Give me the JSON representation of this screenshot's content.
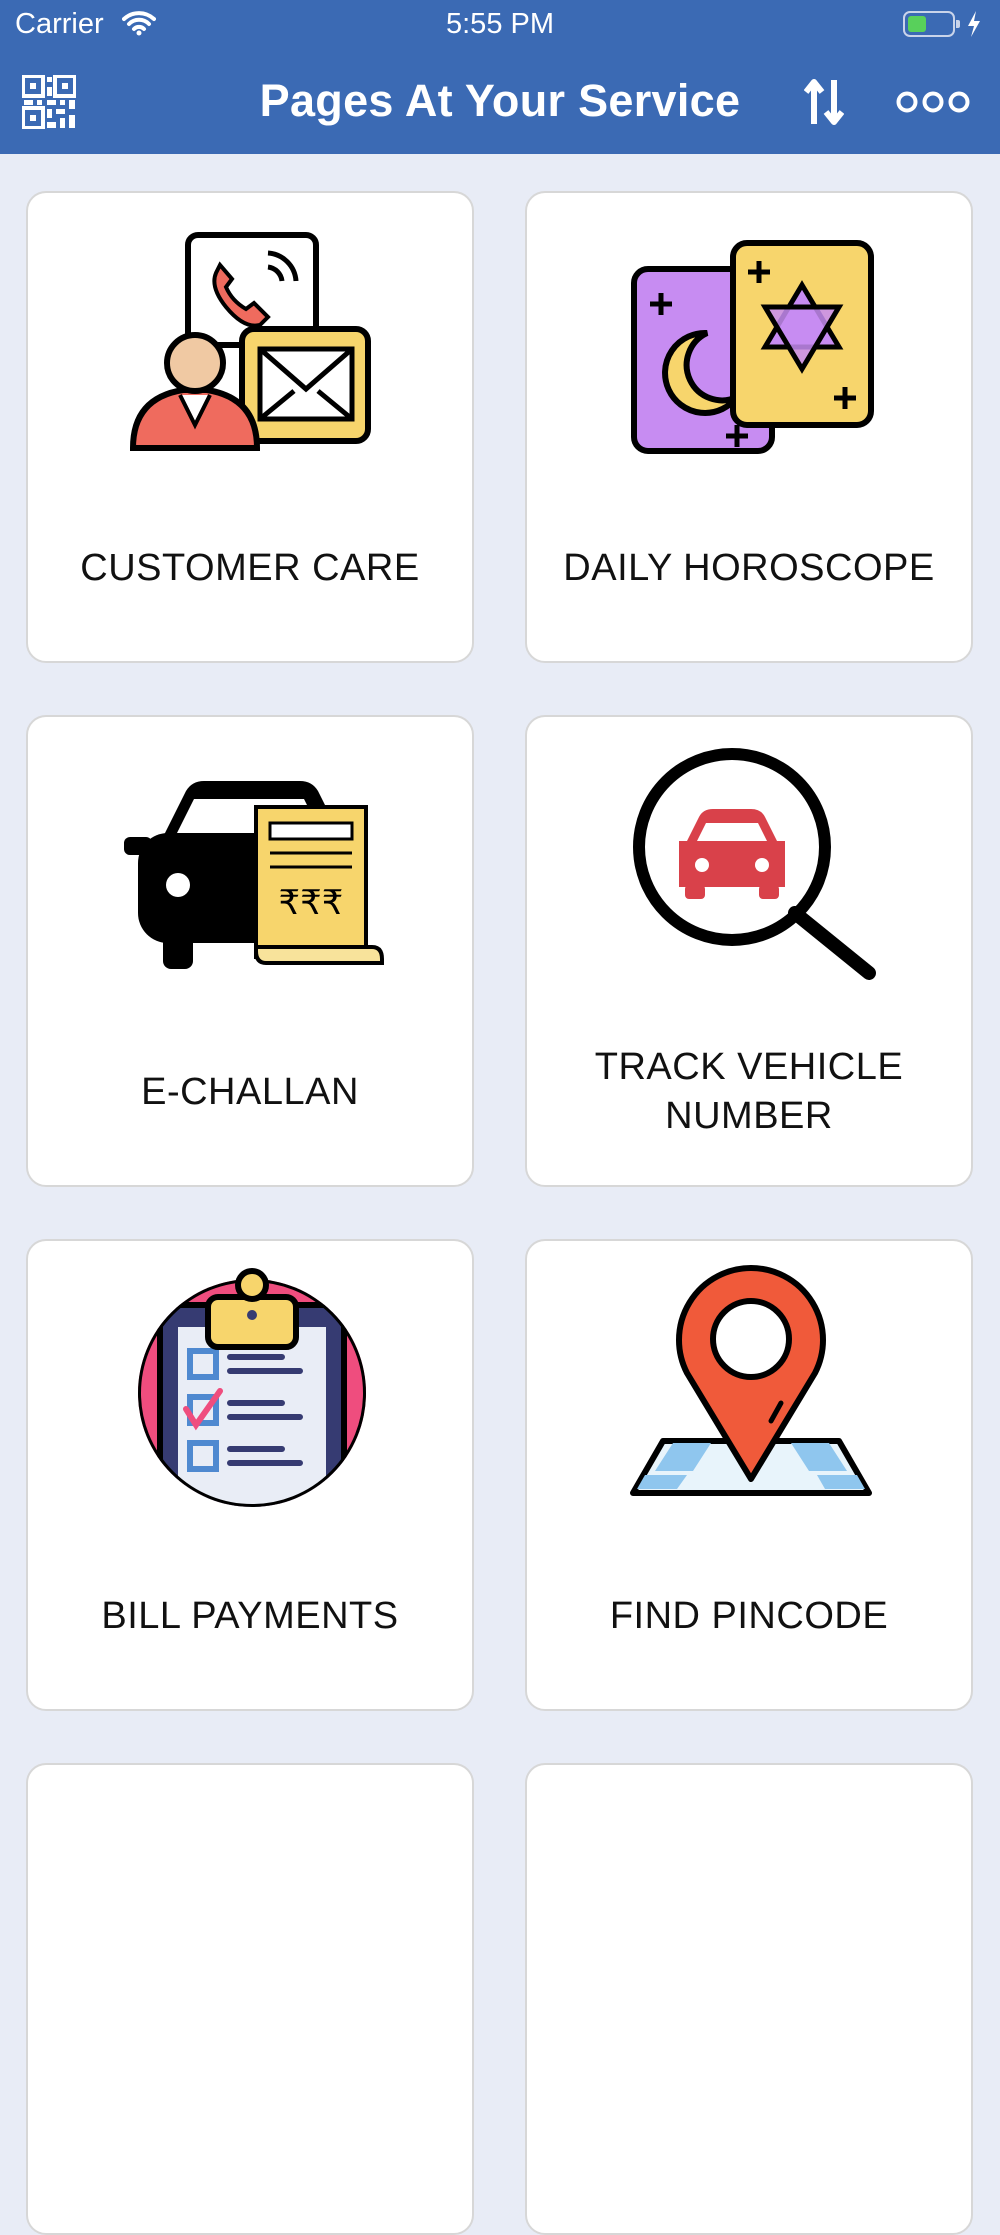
{
  "status_bar": {
    "carrier": "Carrier",
    "time": "5:55 PM"
  },
  "nav": {
    "title": "Pages At Your Service",
    "qr_icon": "qr-code-icon",
    "sort_icon": "sort-icon",
    "more_icon": "more-dots-icon"
  },
  "colors": {
    "header": "#3b6ab4",
    "background": "#e8ecf6",
    "card": "#ffffff"
  },
  "services": [
    {
      "label": "CUSTOMER CARE",
      "icon": "customer-care-icon"
    },
    {
      "label": "DAILY HOROSCOPE",
      "icon": "horoscope-icon"
    },
    {
      "label": "E-CHALLAN",
      "icon": "car-challan-icon"
    },
    {
      "label": "TRACK VEHICLE NUMBER",
      "icon": "vehicle-search-icon"
    },
    {
      "label": "BILL PAYMENTS",
      "icon": "clipboard-checklist-icon"
    },
    {
      "label": "FIND PINCODE",
      "icon": "map-pin-icon"
    }
  ]
}
